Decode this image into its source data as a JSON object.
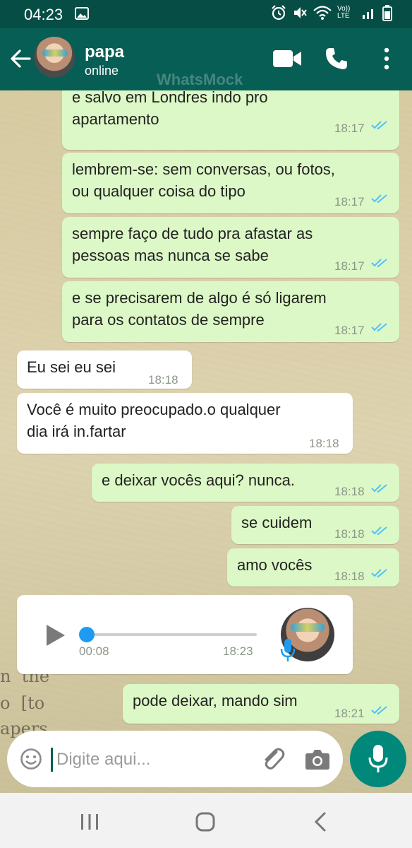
{
  "status_bar": {
    "time": "04:23",
    "network": "Vo)) LTE"
  },
  "header": {
    "contact_name": "papa",
    "status": "online",
    "watermark": "WhatsMock"
  },
  "messages": [
    {
      "dir": "out",
      "text_lines": [
        "e salvo em Londres indo pro",
        "apartamento"
      ],
      "time": "18:17",
      "read": true
    },
    {
      "dir": "out",
      "text_lines": [
        "lembrem-se: sem conversas, ou fotos,",
        "ou qualquer coisa do tipo"
      ],
      "time": "18:17",
      "read": true
    },
    {
      "dir": "out",
      "text_lines": [
        "sempre faço de tudo pra afastar as",
        "pessoas mas nunca se sabe"
      ],
      "time": "18:17",
      "read": true
    },
    {
      "dir": "out",
      "text_lines": [
        "e se precisarem de algo é só ligarem",
        "para os contatos de sempre"
      ],
      "time": "18:17",
      "read": true
    },
    {
      "dir": "in",
      "text_lines": [
        "Eu sei eu sei"
      ],
      "time": "18:18"
    },
    {
      "dir": "in",
      "text_lines": [
        "Você é muito preocupado.o qualquer",
        "dia irá in.fartar"
      ],
      "time": "18:18"
    },
    {
      "dir": "out",
      "text_lines": [
        "e deixar vocês aqui? nunca."
      ],
      "time": "18:18",
      "read": true
    },
    {
      "dir": "out",
      "text_lines": [
        "se cuidem"
      ],
      "time": "18:18",
      "read": true
    },
    {
      "dir": "out",
      "text_lines": [
        "amo vocês"
      ],
      "time": "18:18",
      "read": true
    },
    {
      "dir": "out",
      "text_lines": [
        "pode deixar, mando sim"
      ],
      "time": "18:21",
      "read": true
    }
  ],
  "voice_message": {
    "duration": "00:08",
    "time": "18:23",
    "progress": 0
  },
  "input": {
    "placeholder": "Digite aqui..."
  },
  "colors": {
    "header": "#075e54",
    "status_bar": "#064e45",
    "outgoing": "#dcf8c6",
    "incoming": "#ffffff",
    "ticks": "#4fc3f7",
    "fab": "#00897b"
  },
  "icons": [
    "back-arrow-icon",
    "video-call-icon",
    "phone-icon",
    "more-vert-icon",
    "play-icon",
    "mic-icon",
    "emoji-icon",
    "attach-icon",
    "camera-icon",
    "double-check-icon"
  ]
}
